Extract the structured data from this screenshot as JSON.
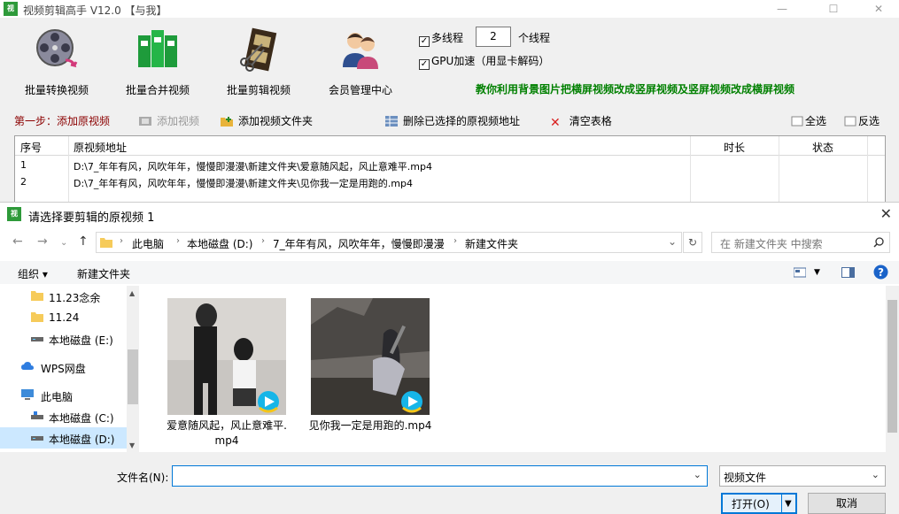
{
  "window": {
    "title": "视频剪辑高手 V12.0 【与我】",
    "icon": "视频"
  },
  "toolbar": {
    "items": [
      {
        "label": "批量转换视频",
        "icon": "film-reel-icon"
      },
      {
        "label": "批量合并视频",
        "icon": "merge-blocks-icon"
      },
      {
        "label": "批量剪辑视频",
        "icon": "film-strip-scissors-icon"
      },
      {
        "label": "会员管理中心",
        "icon": "users-icon"
      }
    ],
    "multithread_label": "多线程",
    "multithread_checked": true,
    "thread_count": "2",
    "thread_suffix": "个线程",
    "gpu_label": "GPU加速（用显卡解码）",
    "gpu_checked": true,
    "promo": "教你利用背景图片把横屏视频改成竖屏视频及竖屏视频改成横屏视频"
  },
  "stepbar": {
    "step_label": "第一步：添加原视频",
    "add_video": "添加视频",
    "add_folder": "添加视频文件夹",
    "delete_selected": "删除已选择的原视频地址",
    "clear_table": "清空表格",
    "select_all": "全选",
    "invert": "反选"
  },
  "table": {
    "columns": [
      "序号",
      "原视频地址",
      "时长",
      "状态"
    ],
    "rows": [
      {
        "index": "1",
        "path": "D:\\7_年年有风，风吹年年，慢慢即漫漫\\新建文件夹\\爱意随风起，风止意难平.mp4",
        "duration": "",
        "status": ""
      },
      {
        "index": "2",
        "path": "D:\\7_年年有风，风吹年年，慢慢即漫漫\\新建文件夹\\见你我一定是用跑的.mp4",
        "duration": "",
        "status": ""
      }
    ]
  },
  "dialog": {
    "title": "请选择要剪辑的原视频 1",
    "breadcrumb": [
      "此电脑",
      "本地磁盘 (D:)",
      "7_年年有风，风吹年年，慢慢即漫漫",
      "新建文件夹"
    ],
    "search_placeholder": "在 新建文件夹 中搜索",
    "organize": "组织 ▾",
    "new_folder": "新建文件夹",
    "nav": [
      {
        "label": "11.23念余",
        "icon": "folder-icon"
      },
      {
        "label": "11.24",
        "icon": "folder-icon"
      },
      {
        "label": "本地磁盘 (E:)",
        "icon": "drive-icon"
      },
      {
        "label": "WPS网盘",
        "icon": "cloud-icon"
      },
      {
        "label": "此电脑",
        "icon": "computer-icon"
      },
      {
        "label": "本地磁盘 (C:)",
        "icon": "drive-icon"
      },
      {
        "label": "本地磁盘 (D:)",
        "icon": "drive-icon"
      }
    ],
    "files": [
      {
        "name_line1": "爱意随风起，风止意难平.",
        "name_line2": "mp4"
      },
      {
        "name_line1": "见你我一定是用跑的.mp4",
        "name_line2": ""
      }
    ],
    "filename_label": "文件名(N):",
    "filename_value": "",
    "filetype": "视频文件",
    "open_button": "打开(O)",
    "cancel_button": "取消"
  }
}
